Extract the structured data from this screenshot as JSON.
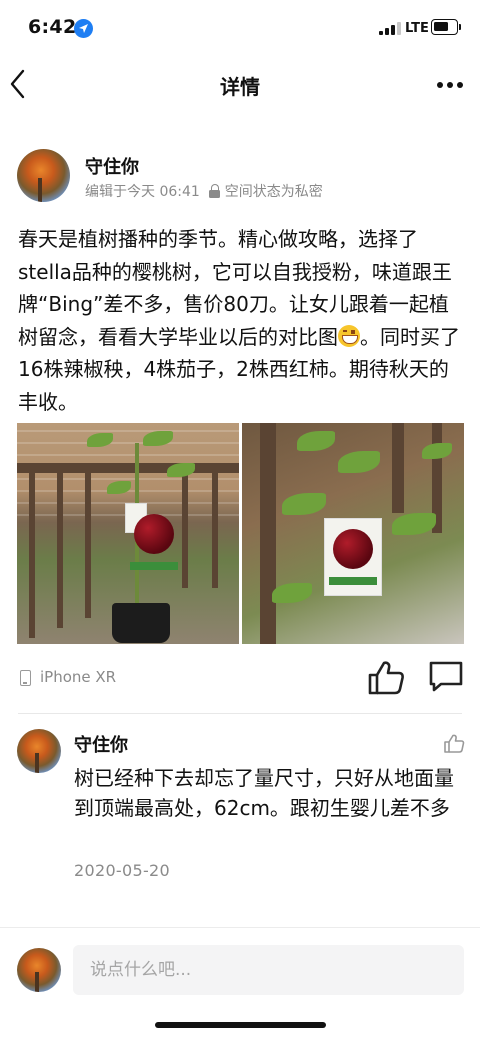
{
  "status_bar": {
    "time": "6:42",
    "network": "LTE",
    "battery_level": 0.7
  },
  "nav": {
    "title": "详情",
    "back_icon": "chevron-left-icon",
    "more_icon": "more-horizontal-icon"
  },
  "post": {
    "author": "守住你",
    "edited": "编辑于今天 06:41",
    "privacy": "空间状态为私密",
    "text_part1": "春天是植树播种的季节。精心做攻略，选择了stella品种的樱桃树，它可以自我授粉，味道跟王牌“Bing”差不多，售价80刀。让女儿跟着一起植树留念，看看大学毕业以后的对比图",
    "text_part2": "。同时买了16株辣椒秧，4株茄子，2株西红柿。期待秋天的丰收。",
    "emoji": "grinning-face-icon",
    "device": "iPhone XR",
    "like_icon": "thumbs-up-icon",
    "comment_icon": "comment-icon"
  },
  "comment": {
    "author": "守住你",
    "text": "树已经种下去却忘了量尺寸，只好从地面量到顶端最高处，62cm。跟初生婴儿差不多",
    "date": "2020-05-20",
    "like_icon": "thumbs-up-icon"
  },
  "reply": {
    "placeholder": "说点什么吧..."
  }
}
